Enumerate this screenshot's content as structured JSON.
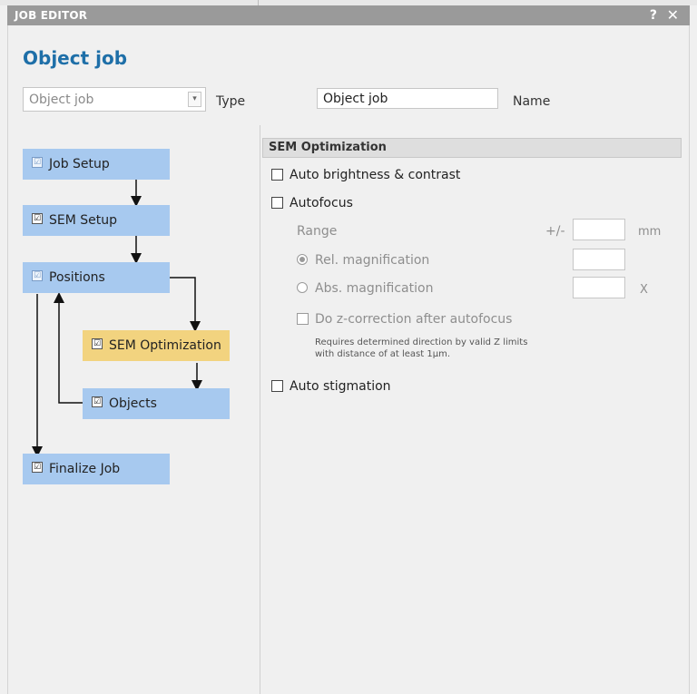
{
  "window": {
    "title": "JOB EDITOR",
    "help_glyph": "?",
    "close_glyph": "✕"
  },
  "header": {
    "heading": "Object job",
    "type_value": "Object job",
    "type_label": "Type",
    "name_value": "Object job",
    "name_label": "Name"
  },
  "flow": {
    "steps": [
      {
        "label": "Job Setup",
        "check": "☑"
      },
      {
        "label": "SEM Setup",
        "check": "☑"
      },
      {
        "label": "Positions",
        "check": "☑"
      },
      {
        "label": "SEM Optimization",
        "check": "☑"
      },
      {
        "label": "Objects",
        "check": "☑"
      },
      {
        "label": "Finalize Job",
        "check": "☑"
      }
    ],
    "active_color": "#f2d37f",
    "step_color": "#a7c9ef"
  },
  "panel": {
    "title": "SEM Optimization",
    "auto_brightness": "Auto brightness & contrast",
    "autofocus": "Autofocus",
    "range_label": "Range",
    "range_prefix": "+/-",
    "range_unit": "mm",
    "rel_mag": "Rel. magnification",
    "abs_mag": "Abs. magnification",
    "abs_unit": "X",
    "z_correction": "Do z-correction after autofocus",
    "note_line1": "Requires determined direction by valid Z limits",
    "note_line2": "with distance of at least 1µm.",
    "auto_stigmation": "Auto stigmation"
  },
  "colors": {
    "accent": "#1e6fa8",
    "titlebar": "#9a9a9a"
  }
}
